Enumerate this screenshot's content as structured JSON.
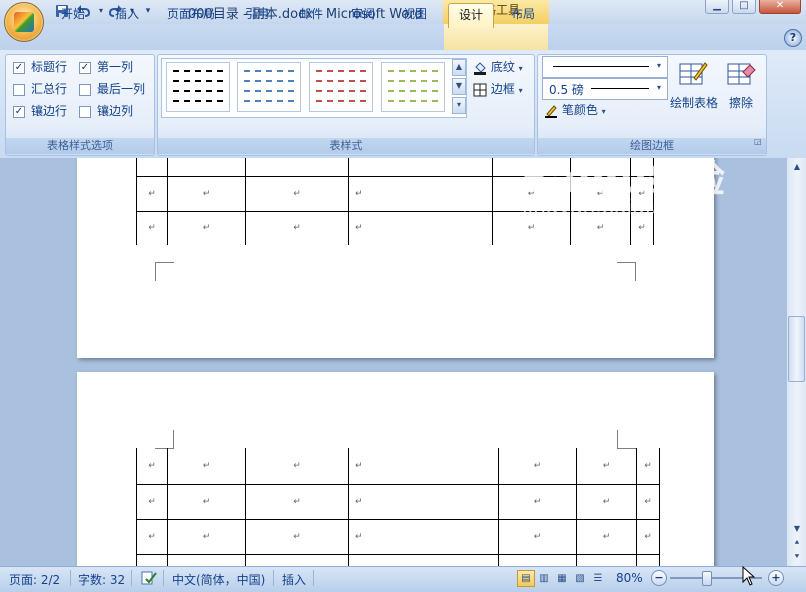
{
  "window": {
    "title": "000目录 - 副本.docx - Microsoft Word",
    "contextual_tab_group": "表格工具",
    "controls": {
      "minimize": "▁",
      "maximize": "□",
      "close": "✕"
    }
  },
  "quick_access": {
    "save_icon": "save-icon",
    "undo_icon": "undo-icon",
    "redo_icon": "redo-icon",
    "customize": "▾"
  },
  "tabs": [
    "开始",
    "插入",
    "页面布局",
    "引用",
    "邮件",
    "审阅",
    "视图",
    "设计",
    "布局"
  ],
  "active_tab": "设计",
  "ribbon": {
    "style_options": {
      "label": "表格样式选项",
      "items": [
        {
          "label": "标题行",
          "checked": true
        },
        {
          "label": "第一列",
          "checked": true
        },
        {
          "label": "汇总行",
          "checked": false
        },
        {
          "label": "最后一列",
          "checked": false
        },
        {
          "label": "镶边行",
          "checked": true
        },
        {
          "label": "镶边列",
          "checked": false
        }
      ]
    },
    "table_styles": {
      "label": "表样式",
      "shading_label": "底纹",
      "borders_label": "边框",
      "thumb_colors": [
        "#000000",
        "#4f81bd",
        "#c0504d",
        "#9bbb59"
      ]
    },
    "draw_borders": {
      "label": "绘图边框",
      "pen_weight": "0.5 磅",
      "pen_color_label": "笔颜色",
      "draw_table_label": "绘制表格",
      "eraser_label": "擦除"
    }
  },
  "document": {
    "cell_mark": "↵"
  },
  "statusbar": {
    "page": "页面: 2/2",
    "words": "字数: 32",
    "language": "中文(简体，中国)",
    "mode": "插入",
    "zoom": "80%",
    "zoom_minus": "−",
    "zoom_plus": "+"
  },
  "watermark": {
    "brand": "Baidu经验",
    "url": "jingyan.baidu.com"
  }
}
